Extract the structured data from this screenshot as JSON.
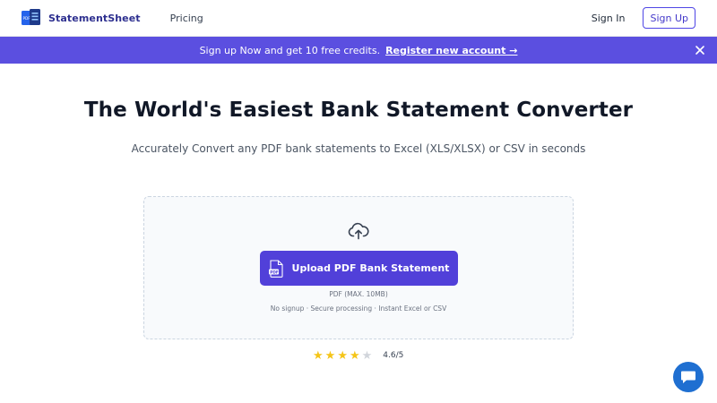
{
  "header": {
    "brand_name": "StatementSheet",
    "logo_text": "PDF",
    "nav_pricing": "Pricing",
    "sign_in": "Sign In",
    "sign_up": "Sign Up"
  },
  "promo": {
    "text": "Sign up Now and get 10 free credits.",
    "link": "Register new account →",
    "close_icon": "close-icon"
  },
  "hero": {
    "title": "The World's Easiest Bank Statement Converter",
    "subtitle": "Accurately Convert any PDF bank statements to Excel (XLS/XLSX) or CSV in seconds"
  },
  "upload": {
    "icon": "cloud-upload-icon",
    "button_label": "Upload PDF Bank Statement",
    "button_icon_text": "PDF",
    "file_hint": "PDF (MAX. 10MB)",
    "features": "No signup · Secure processing · Instant Excel or CSV"
  },
  "rating": {
    "value": "4.6/5",
    "stars_full": 4,
    "stars_total": 5
  },
  "chat": {
    "icon": "chat-bubble-icon"
  },
  "colors": {
    "brand": "#5b4fe0",
    "button": "#5140d9",
    "chat": "#1f6fd1",
    "star": "#f5c518"
  }
}
